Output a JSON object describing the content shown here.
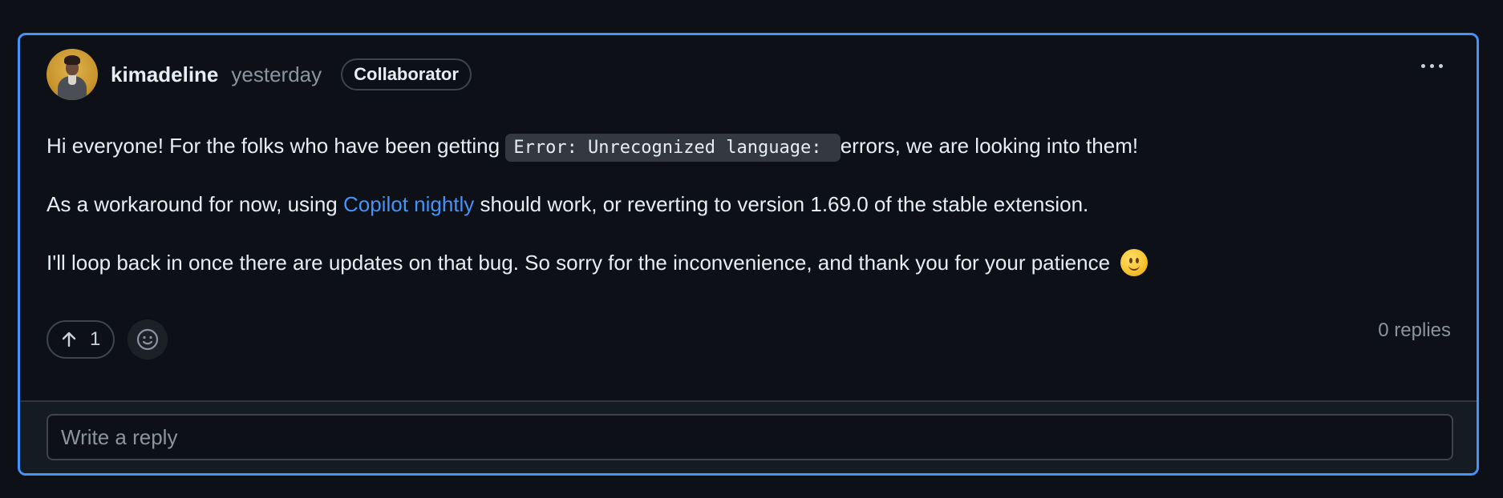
{
  "comment": {
    "author": "kimadeline",
    "timestamp": "yesterday",
    "badge": "Collaborator",
    "more_icon": "kebab-horizontal-icon",
    "paragraph1": {
      "before": "Hi everyone! For the folks who have been getting ",
      "code": "Error: Unrecognized language: ",
      "after": " errors, we are looking into them!"
    },
    "paragraph2": {
      "before": "As a workaround for now, using ",
      "link": "Copilot nightly",
      "after": " should work, or reverting to version 1.69.0 of the stable extension."
    },
    "paragraph3": {
      "text": "I'll loop back in once there are updates on that bug. So sorry for the inconvenience, and thank you for your patience",
      "emoji": "slightly-smiling-face-emoji"
    },
    "upvote": {
      "icon": "arrow-up-icon",
      "count": "1"
    },
    "reaction_icon": "smiley-icon",
    "replies": "0 replies"
  },
  "reply": {
    "placeholder": "Write a reply"
  },
  "colors": {
    "background": "#0d1117",
    "accent_border": "#4493f8",
    "link": "#4493f8",
    "muted_text": "#8b949e"
  }
}
